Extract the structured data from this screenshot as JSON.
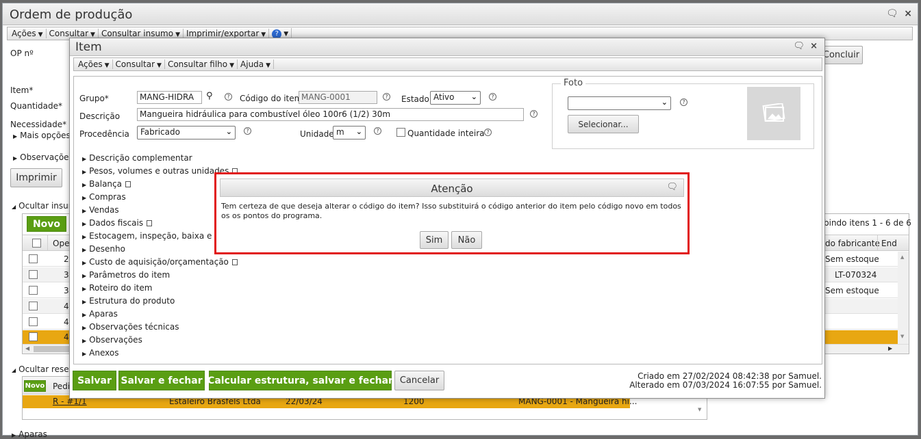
{
  "main": {
    "title": "Ordem de produção",
    "menu": [
      "Ações",
      "Consultar",
      "Consultar insumo",
      "Imprimir/exportar"
    ],
    "labels": {
      "op": "OP nº",
      "item": "Item*",
      "quantidade": "Quantidade*",
      "necessidade": "Necessidade*",
      "mais_opcoes": "Mais opções",
      "observacoes": "Observações",
      "ocultar_insumos": "Ocultar insum",
      "ocultar_reservas": "Ocultar reser",
      "aparas": "Aparas"
    },
    "buttons": {
      "concluir": "Concluir",
      "imprimir": "Imprimir",
      "novo": "Novo",
      "novo_small": "Novo"
    },
    "grid": {
      "header_ope": "Ope",
      "header_fab": "do fabricante",
      "header_end": "End",
      "paging": "bindo itens 1 - 6 de 6",
      "left_values": [
        "2",
        "3",
        "3",
        "4",
        "4",
        "4"
      ],
      "right_values": [
        "Sem estoque",
        "LT-070324",
        "Sem estoque",
        "",
        "",
        ""
      ]
    },
    "reserves": {
      "header": "Pedi",
      "row": [
        "R - #1/1",
        "Estaleiro Brasfels Ltda",
        "22/03/24",
        "1200",
        "MANG-0001 - Mangueira hi..."
      ]
    }
  },
  "item_dialog": {
    "title": "Item",
    "menu": [
      "Ações",
      "Consultar",
      "Consultar filho",
      "Ajuda"
    ],
    "fields": {
      "grupo_label": "Grupo*",
      "grupo_value": "MANG-HIDRA",
      "codigo_label": "Código do item",
      "codigo_value": "MANG-0001",
      "estado_label": "Estado",
      "estado_value": "Ativo",
      "descricao_label": "Descrição",
      "descricao_value": "Mangueira hidráulica para combustível óleo 100r6 (1/2) 30m",
      "procedencia_label": "Procedência",
      "procedencia_value": "Fabricado",
      "unidade_label": "Unidade",
      "unidade_value": "m",
      "quantidade_inteira_label": "Quantidade inteira"
    },
    "foto": {
      "legend": "Foto",
      "select_value": "",
      "button": "Selecionar..."
    },
    "sections": [
      "Descrição complementar",
      "Pesos, volumes e outras unidades",
      "Balança",
      "Compras",
      "Vendas",
      "Dados fiscais",
      "Estocagem, inspeção, baixa e plane",
      "Desenho",
      "Custo de aquisição/orçamentação",
      "Parâmetros do item",
      "Roteiro do item",
      "Estrutura do produto",
      "Aparas",
      "Observações técnicas",
      "Observações",
      "Anexos"
    ],
    "footer": {
      "salvar": "Salvar",
      "salvar_fechar": "Salvar e fechar",
      "calcular": "Calcular estrutura, salvar e fechar",
      "cancelar": "Cancelar",
      "criado": "Criado em 27/02/2024 08:42:38 por Samuel.",
      "alterado": "Alterado em 07/03/2024 16:07:55 por Samuel."
    }
  },
  "confirm": {
    "title": "Atenção",
    "message": "Tem certeza de que deseja alterar o código do item? Isso substituirá o código anterior do item pelo código novo em todos os os pontos do programa.",
    "yes": "Sim",
    "no": "Não"
  },
  "colors": {
    "green": "#5a9e13",
    "highlight_row": "#e8a712",
    "modal_border": "#e11515"
  }
}
